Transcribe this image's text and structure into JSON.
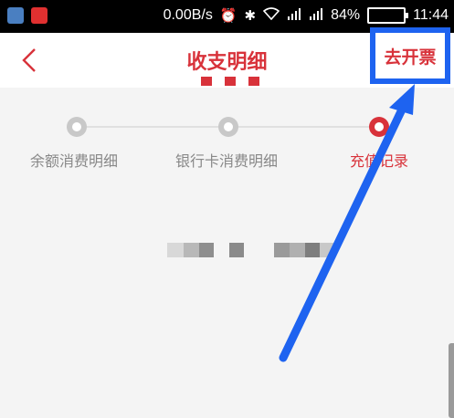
{
  "status_bar": {
    "speed": "0.00B/s",
    "battery": "84%",
    "battery_fraction": 0.84,
    "time": "11:44",
    "icons": [
      "alarm-icon",
      "bluetooth-icon",
      "wifi-icon",
      "signal-icon",
      "signal-icon"
    ]
  },
  "header": {
    "back_icon": "chevron-left-icon",
    "title": "收支明细",
    "invoice_label": "去开票"
  },
  "steps": [
    {
      "label": "余额消费明细",
      "active": false
    },
    {
      "label": "银行卡消费明细",
      "active": false
    },
    {
      "label": "充值记录",
      "active": true
    }
  ],
  "colors": {
    "accent": "#d8323a",
    "highlight": "#1e63f0",
    "inactive": "#c8c8c8"
  }
}
